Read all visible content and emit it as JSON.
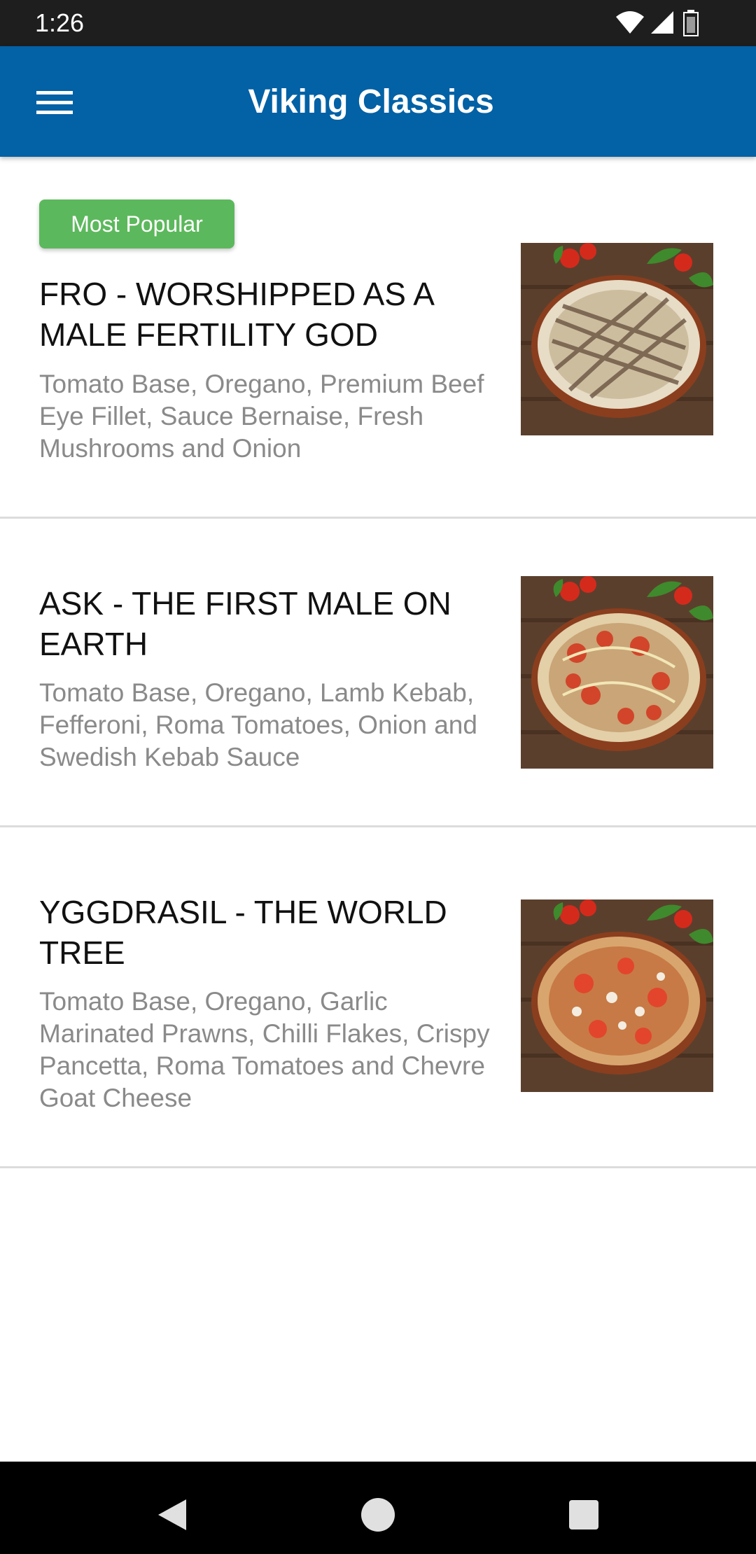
{
  "status_bar": {
    "time": "1:26",
    "icons": [
      "wifi-icon",
      "signal-icon",
      "battery-icon"
    ]
  },
  "app_bar": {
    "title": "Viking Classics",
    "menu_icon": "hamburger-menu-icon",
    "color": "#0361a5"
  },
  "items": [
    {
      "badge": "Most Popular",
      "title": "FRO - WORSHIPPED AS A MALE FERTILITY GOD",
      "description": "Tomato Base, Oregano, Premium Beef Eye Fillet, Sauce Bernaise, Fresh Mushrooms and Onion",
      "image": "pizza-photo"
    },
    {
      "title": "ASK - THE FIRST MALE ON EARTH",
      "description": "Tomato Base, Oregano, Lamb Kebab, Fefferoni, Roma Tomatoes, Onion and Swedish Kebab Sauce",
      "image": "pizza-photo"
    },
    {
      "title": "YGGDRASIL - THE WORLD TREE",
      "description": "Tomato Base, Oregano, Garlic Marinated Prawns, Chilli Flakes, Crispy Pancetta, Roma Tomatoes and Chevre Goat Cheese",
      "image": "pizza-photo"
    }
  ],
  "nav_bar": {
    "back_icon": "back-triangle-icon",
    "home_icon": "home-circle-icon",
    "recents_icon": "recents-square-icon"
  },
  "colors": {
    "badge": "#5cb85c",
    "description_text": "#8a8a8a",
    "divider": "#dcdcdc"
  }
}
